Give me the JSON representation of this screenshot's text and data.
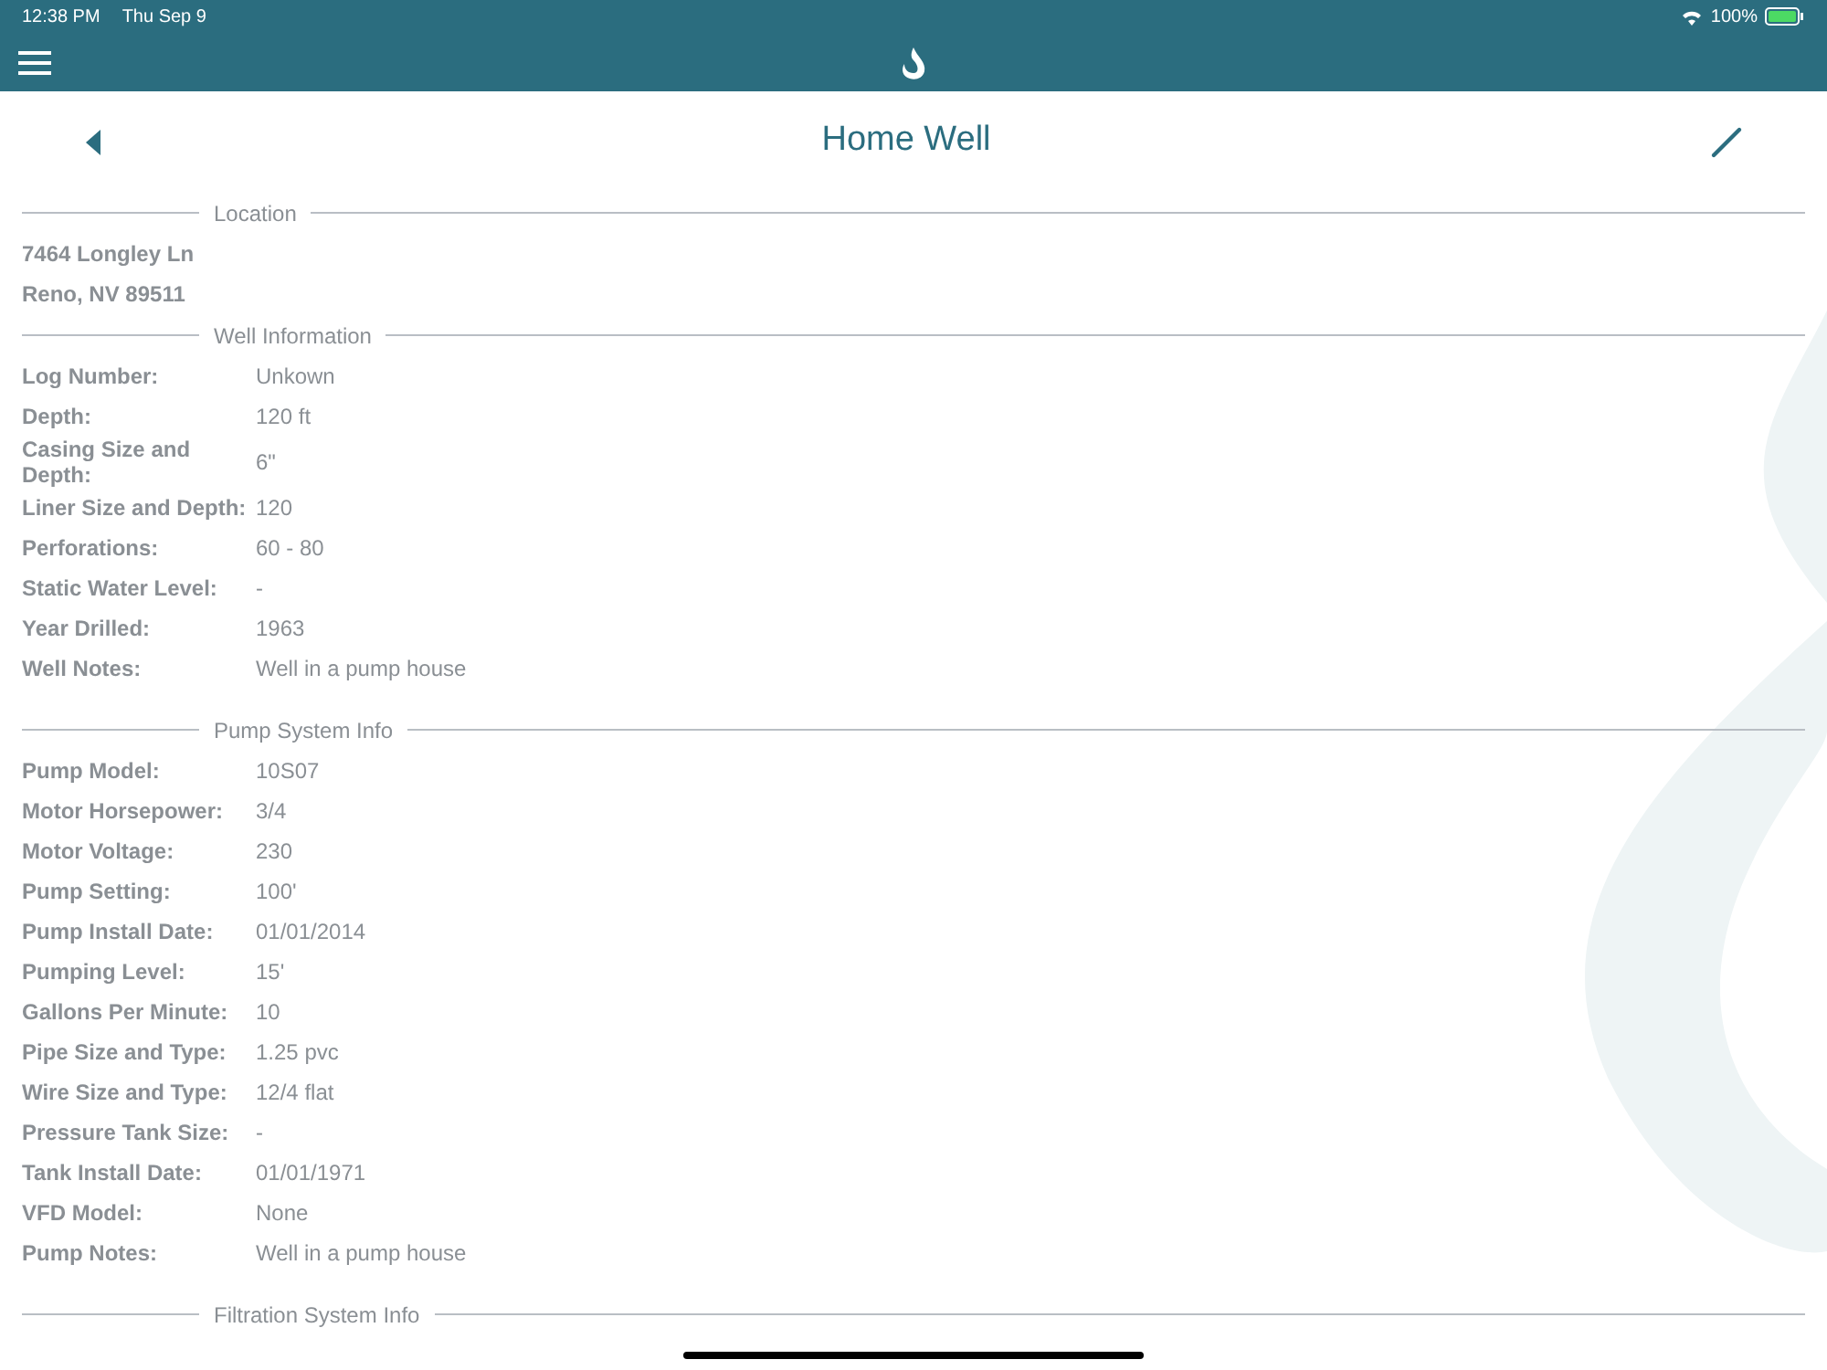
{
  "status_bar": {
    "time": "12:38 PM",
    "date": "Thu Sep 9",
    "battery": "100%"
  },
  "page": {
    "title": "Home Well"
  },
  "sections": [
    {
      "title": "Location",
      "kind": "lines",
      "lines": [
        "7464 Longley Ln",
        "Reno, NV 89511"
      ]
    },
    {
      "title": "Well Information",
      "kind": "fields",
      "fields": [
        {
          "label": "Log Number:",
          "value": "Unkown"
        },
        {
          "label": "Depth:",
          "value": "120 ft"
        },
        {
          "label": "Casing Size and Depth:",
          "value": "6\""
        },
        {
          "label": "Liner Size and Depth:",
          "value": "120"
        },
        {
          "label": "Perforations:",
          "value": "60 - 80"
        },
        {
          "label": "Static Water Level:",
          "value": "-"
        },
        {
          "label": "Year Drilled:",
          "value": "1963"
        },
        {
          "label": "Well Notes:",
          "value": "Well in a pump house"
        }
      ]
    },
    {
      "title": "Pump System Info",
      "kind": "fields",
      "fields": [
        {
          "label": "Pump Model:",
          "value": "10S07"
        },
        {
          "label": "Motor Horsepower:",
          "value": "3/4"
        },
        {
          "label": "Motor Voltage:",
          "value": "230"
        },
        {
          "label": "Pump Setting:",
          "value": "100'"
        },
        {
          "label": "Pump Install Date:",
          "value": "01/01/2014"
        },
        {
          "label": "Pumping Level:",
          "value": "15'"
        },
        {
          "label": "Gallons Per Minute:",
          "value": "10"
        },
        {
          "label": "Pipe Size and Type:",
          "value": "1.25 pvc"
        },
        {
          "label": "Wire Size and Type:",
          "value": "12/4 flat"
        },
        {
          "label": "Pressure Tank Size:",
          "value": "-"
        },
        {
          "label": "Tank Install Date:",
          "value": "01/01/1971"
        },
        {
          "label": "VFD Model:",
          "value": "None"
        },
        {
          "label": "Pump Notes:",
          "value": "Well in a pump house"
        }
      ]
    },
    {
      "title": "Filtration System Info",
      "kind": "header"
    }
  ]
}
